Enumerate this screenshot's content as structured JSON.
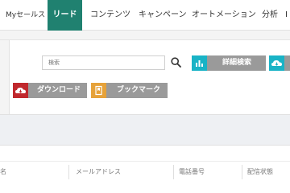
{
  "nav": {
    "items": [
      {
        "label": "Myセールス"
      },
      {
        "label": "リード",
        "active": true
      },
      {
        "label": "コンテンツ"
      },
      {
        "label": "キャンペーン"
      },
      {
        "label": "オートメーション"
      },
      {
        "label": "分析"
      },
      {
        "label": "I"
      }
    ]
  },
  "search": {
    "placeholder": "検索"
  },
  "buttons": {
    "detail_search": "詳細検索",
    "download": "ダウンロード",
    "bookmark": "ブックマーク"
  },
  "table": {
    "headers": [
      "名",
      "メールアドレス",
      "電話番号",
      "配信状態"
    ]
  },
  "colors": {
    "accent": "#208170",
    "teal_icon": "#19b3c6",
    "download_icon": "#c0282d",
    "bookmark_icon": "#e6a23a",
    "button_gray": "#9a9a9a"
  }
}
